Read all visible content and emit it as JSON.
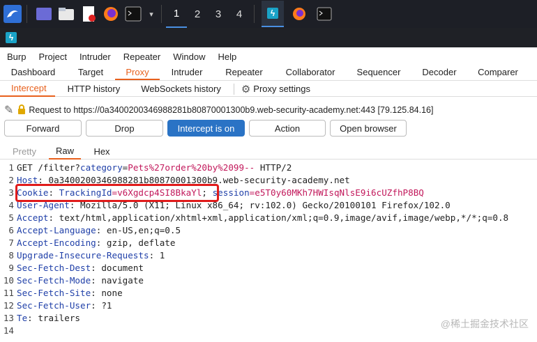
{
  "taskbar": {
    "workspaces": [
      "1",
      "2",
      "3",
      "4"
    ]
  },
  "menu": [
    "Burp",
    "Project",
    "Intruder",
    "Repeater",
    "Window",
    "Help"
  ],
  "main_tabs": [
    "Dashboard",
    "Target",
    "Proxy",
    "Intruder",
    "Repeater",
    "Collaborator",
    "Sequencer",
    "Decoder",
    "Comparer"
  ],
  "sub_tabs": {
    "intercept": "Intercept",
    "http_history": "HTTP history",
    "websockets_history": "WebSockets history",
    "proxy_settings": "Proxy settings"
  },
  "request_info": "Request to https://0a3400200346988281b80870001300b9.web-security-academy.net:443  [79.125.84.16]",
  "buttons": {
    "forward": "Forward",
    "drop": "Drop",
    "intercept": "Intercept is on",
    "action": "Action",
    "open_browser": "Open browser"
  },
  "editor_tabs": {
    "pretty": "Pretty",
    "raw": "Raw",
    "hex": "Hex"
  },
  "request_lines": {
    "l1": {
      "num": "1",
      "method": "GET /filter?",
      "param_key": "category",
      "eq": "=",
      "param_val": "Pets%27order%20by%2099--",
      "proto": " HTTP/2"
    },
    "l2": {
      "num": "2",
      "key": "Host",
      "value": ": 0a3400200346988281b80870001300b9.web-security-academy.net"
    },
    "l3": {
      "num": "3",
      "key": "Cookie",
      "colon": ": ",
      "c1k": "TrackingId",
      "c1v": "=v6Xgdcp4SI8BkaYl",
      "sep": "; ",
      "c2k": "session",
      "c2v": "=e5T0y60MKh7HWIsqNlsE9i6cUZfhP8BQ"
    },
    "l4": {
      "num": "4",
      "key": "User-Agent",
      "value": ": Mozilla/5.0 (X11; Linux x86_64; rv:102.0) Gecko/20100101 Firefox/102.0"
    },
    "l5": {
      "num": "5",
      "key": "Accept",
      "value": ": text/html,application/xhtml+xml,application/xml;q=0.9,image/avif,image/webp,*/*;q=0.8"
    },
    "l6": {
      "num": "6",
      "key": "Accept-Language",
      "value": ": en-US,en;q=0.5"
    },
    "l7": {
      "num": "7",
      "key": "Accept-Encoding",
      "value": ": gzip, deflate"
    },
    "l8": {
      "num": "8",
      "key": "Upgrade-Insecure-Requests",
      "value": ": 1"
    },
    "l9": {
      "num": "9",
      "key": "Sec-Fetch-Dest",
      "value": ": document"
    },
    "l10": {
      "num": "10",
      "key": "Sec-Fetch-Mode",
      "value": ": navigate"
    },
    "l11": {
      "num": "11",
      "key": "Sec-Fetch-Site",
      "value": ": none"
    },
    "l12": {
      "num": "12",
      "key": "Sec-Fetch-User",
      "value": ": ?1"
    },
    "l13": {
      "num": "13",
      "key": "Te",
      "value": ": trailers"
    },
    "l14": {
      "num": "14"
    }
  },
  "watermark": "@稀土掘金技术社区",
  "colors": {
    "accent": "#e8601c",
    "primary_button": "#2a73c5",
    "highlight_box": "#e01b1b",
    "header_key": "#1f3fa8",
    "param_value": "#c2185b"
  }
}
